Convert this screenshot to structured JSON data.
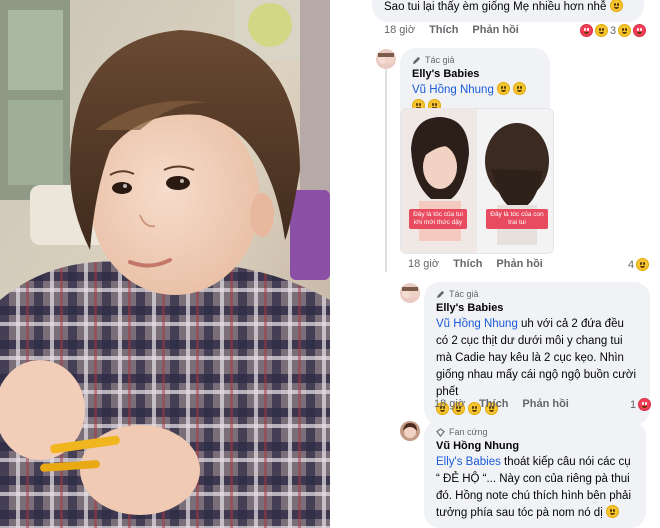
{
  "comments": [
    {
      "text": "Sao tui lại thấy èm giống Mẹ nhiều hơn nhễ",
      "time": "18 giờ",
      "like_label": "Thích",
      "reply_label": "Phản hồi",
      "reaction_count": "3"
    },
    {
      "badge": "Tác giả",
      "author": "Elly's Babies",
      "mention": "Vũ Hồng Nhung",
      "time": "18 giờ",
      "like_label": "Thích",
      "reply_label": "Phản hồi",
      "images": [
        {
          "caption": "Đây là tóc của tui khi mới thức dậy"
        },
        {
          "caption": "Đây là tóc của con trai tui"
        }
      ],
      "reaction_count": "4"
    },
    {
      "badge": "Tác giả",
      "author": "Elly's Babies",
      "mention": "Vũ Hồng Nhung",
      "text": " uh với cả 2 đứa đều có 2 cục thịt dư dưới môi y chang tui mà Cadie hay kêu là 2 cục kẹo. Nhìn giống nhau mấy cái ngộ ngộ buồn cười phết",
      "time": "18 giờ",
      "like_label": "Thích",
      "reply_label": "Phản hồi",
      "reaction_count": "1"
    },
    {
      "badge": "Fan cứng",
      "author": "Vũ Hồng Nhung",
      "mention": "Elly's Babies",
      "text": " thoát kiếp câu nói các cụ “ ĐẺ HỘ “... Này con của riêng pà thui đó. Hồng note chú thích hình bên phải tưởng phía sau tóc pà nom nó dị"
    }
  ],
  "colors": {
    "mention": "#1a5bd8",
    "bubble": "#f0f2f5",
    "meta": "#65676b"
  }
}
